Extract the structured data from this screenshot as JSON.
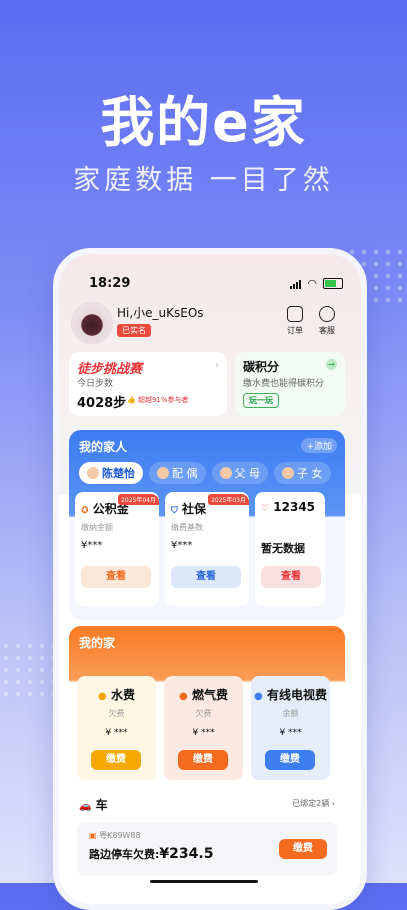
{
  "hero": {
    "title": "我的e家",
    "subtitle": "家庭数据 一目了然"
  },
  "status_bar": {
    "time": "18:29"
  },
  "header": {
    "greeting": "Hi,小e_uKsEOs",
    "verified_badge": "已实名",
    "actions": [
      {
        "label": "订单",
        "icon": "order-icon"
      },
      {
        "label": "客服",
        "icon": "support-icon"
      }
    ]
  },
  "walk": {
    "title": "徒步挑战赛",
    "subtitle": "今日步数",
    "steps": "4028步",
    "rank": "超越91%参与者"
  },
  "carbon": {
    "title": "碳积分",
    "subtitle": "缴水费也能得碳积分",
    "button": "玩一玩"
  },
  "family": {
    "title": "我的家人",
    "add_label": "+添加",
    "members": [
      {
        "label": "陈楚怡",
        "active": true
      },
      {
        "label": "配 偶",
        "active": false
      },
      {
        "label": "父 母",
        "active": false
      },
      {
        "label": "子 女",
        "active": false
      }
    ],
    "services": [
      {
        "name": "公积金",
        "badge": "2025年04月",
        "label": "缴纳金额",
        "value": "¥***",
        "button": "查看",
        "color": "#f46a1f",
        "bg": "#fde7da"
      },
      {
        "name": "社保",
        "badge": "2025年03月",
        "label": "缴费基数",
        "value": "¥***",
        "button": "查看",
        "color": "#2966d9",
        "bg": "#dde8fb"
      },
      {
        "name": "12345",
        "badge": "",
        "label": "",
        "value": "暂无数据",
        "button": "查看",
        "color": "#e9353a",
        "bg": "#fbe0e1"
      }
    ]
  },
  "home": {
    "title": "我的家",
    "bills": [
      {
        "name": "水费",
        "label": "欠费",
        "value": "¥ ***",
        "button": "缴费",
        "btn_color": "#f6a800",
        "bg": "#fff6e4"
      },
      {
        "name": "燃气费",
        "label": "欠费",
        "value": "¥ ***",
        "button": "缴费",
        "btn_color": "#f46a1f",
        "bg": "#fde9e1"
      },
      {
        "name": "有线电视费",
        "label": "余额",
        "value": "¥ ***",
        "button": "缴费",
        "btn_color": "#3c7ef0",
        "bg": "#e5edfb"
      }
    ],
    "car": {
      "label": "车",
      "bound_text": "已绑定2辆",
      "plate": "粤K89W88",
      "parking_label": "路边停车欠费:",
      "parking_amount": "¥234.5",
      "pay_button": "缴费"
    }
  }
}
